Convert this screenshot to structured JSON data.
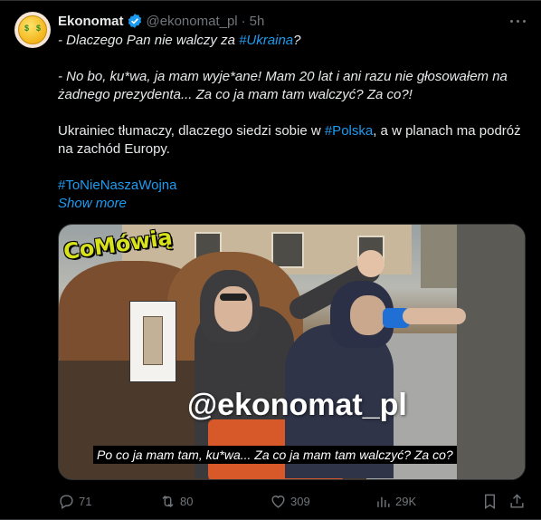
{
  "tweet": {
    "display_name": "Ekonomat",
    "handle": "@ekonomat_pl",
    "separator": "·",
    "time": "5h",
    "line1_prefix": "- Dlaczego Pan nie walczy za ",
    "line1_hashtag": "#Ukraina",
    "line1_suffix": "?",
    "line2": "- No bo, ku*wa, ja mam wyje*ane! Mam 20 lat i ani razu nie głosowałem na żadnego prezydenta... Za co ja mam tam walczyć? Za co?!",
    "line3_prefix": "Ukrainiec tłumaczy, dlaczego siedzi sobie w ",
    "line3_hashtag": "#Polska",
    "line3_suffix": ", a w planach ma podróż na zachód Europy.",
    "hashtag_line": "#ToNieNaszaWojna",
    "show_more": "Show more"
  },
  "media": {
    "logo_text": "CoMówią",
    "watermark": "@ekonomat_pl",
    "subtitle": "Po co ja mam tam, ku*wa... Za co ja mam tam walczyć? Za co?"
  },
  "actions": {
    "replies": "71",
    "reposts": "80",
    "likes": "309",
    "views": "29K"
  },
  "colors": {
    "background": "#000000",
    "text": "#e7e9ea",
    "secondary": "#71767b",
    "accent": "#1d9bf0"
  },
  "icons": [
    "verified-badge-icon",
    "more-icon",
    "reply-icon",
    "repost-icon",
    "like-icon",
    "views-icon",
    "bookmark-icon",
    "share-icon"
  ]
}
